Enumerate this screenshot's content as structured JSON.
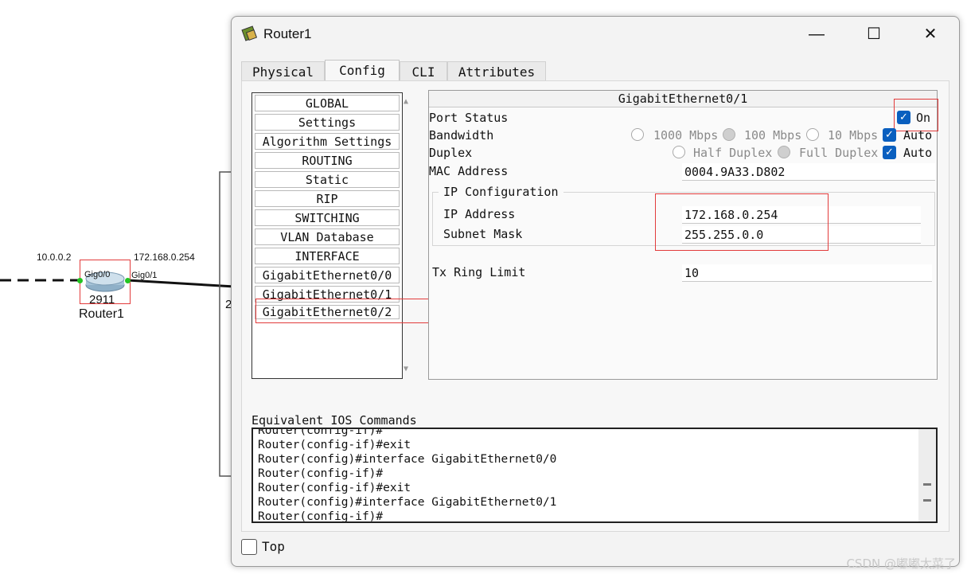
{
  "topology": {
    "left_ip": "10.0.0.2",
    "right_ip": "172.168.0.254",
    "port_left": "Gig0/0",
    "port_right": "Gig0/1",
    "model": "2911",
    "device_name": "Router1",
    "partial_label": "2"
  },
  "window": {
    "title": "Router1",
    "minimize": "—",
    "maximize": "☐",
    "close": "✕"
  },
  "tabs": [
    {
      "label": "Physical"
    },
    {
      "label": "Config"
    },
    {
      "label": "CLI"
    },
    {
      "label": "Attributes"
    }
  ],
  "sidebar": {
    "items": [
      {
        "label": "GLOBAL"
      },
      {
        "label": "Settings"
      },
      {
        "label": "Algorithm Settings"
      },
      {
        "label": "ROUTING"
      },
      {
        "label": "Static"
      },
      {
        "label": "RIP"
      },
      {
        "label": "SWITCHING"
      },
      {
        "label": "VLAN Database"
      },
      {
        "label": "INTERFACE"
      },
      {
        "label": "GigabitEthernet0/0"
      },
      {
        "label": "GigabitEthernet0/1"
      },
      {
        "label": "GigabitEthernet0/2"
      }
    ]
  },
  "interface": {
    "title": "GigabitEthernet0/1",
    "port_status_label": "Port Status",
    "port_on_label": "On",
    "bandwidth_label": "Bandwidth",
    "bw_1000": "1000 Mbps",
    "bw_100": "100 Mbps",
    "bw_10": "10 Mbps",
    "bw_auto": "Auto",
    "duplex_label": "Duplex",
    "half_duplex": "Half Duplex",
    "full_duplex": "Full Duplex",
    "duplex_auto": "Auto",
    "mac_label": "MAC Address",
    "mac_value": "0004.9A33.D802",
    "ip_group_label": "IP Configuration",
    "ip_label": "IP Address",
    "ip_value": "172.168.0.254",
    "mask_label": "Subnet Mask",
    "mask_value": "255.255.0.0",
    "tx_label": "Tx Ring Limit",
    "tx_value": "10"
  },
  "console": {
    "label": "Equivalent IOS Commands",
    "lines": [
      "Router(config-if)#",
      "Router(config-if)#exit",
      "Router(config)#interface GigabitEthernet0/0",
      "Router(config-if)#",
      "Router(config-if)#exit",
      "Router(config)#interface GigabitEthernet0/1",
      "Router(config-if)#"
    ]
  },
  "footer": {
    "top_label": "Top"
  },
  "watermark": "CSDN @嘟嘟太菜了"
}
